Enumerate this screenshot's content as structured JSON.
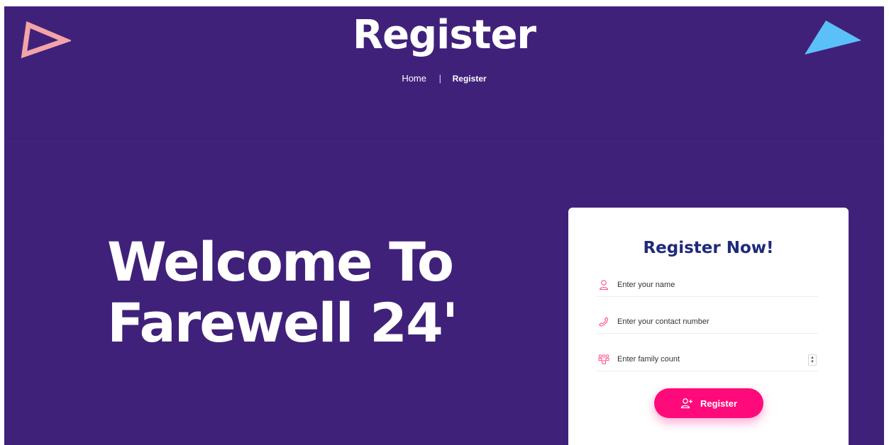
{
  "header": {
    "title": "Register",
    "breadcrumb": {
      "home": "Home",
      "separator": "|",
      "current": "Register"
    }
  },
  "hero": {
    "line1": "Welcome To",
    "line2": "Farewell 24'"
  },
  "form": {
    "title": "Register Now!",
    "fields": {
      "name": {
        "placeholder": "Enter your name",
        "icon": "user-icon"
      },
      "phone": {
        "placeholder": "Enter your contact number",
        "icon": "phone-icon"
      },
      "family": {
        "placeholder": "Enter family count",
        "icon": "family-icon"
      }
    },
    "submit_label": "Register",
    "submit_icon": "user-plus-icon"
  },
  "colors": {
    "background": "#40217a",
    "accent": "#ff0a7a",
    "form_title": "#1f2a7a",
    "deco_left": "#f4a3a8",
    "deco_right": "#5bc0f8"
  }
}
